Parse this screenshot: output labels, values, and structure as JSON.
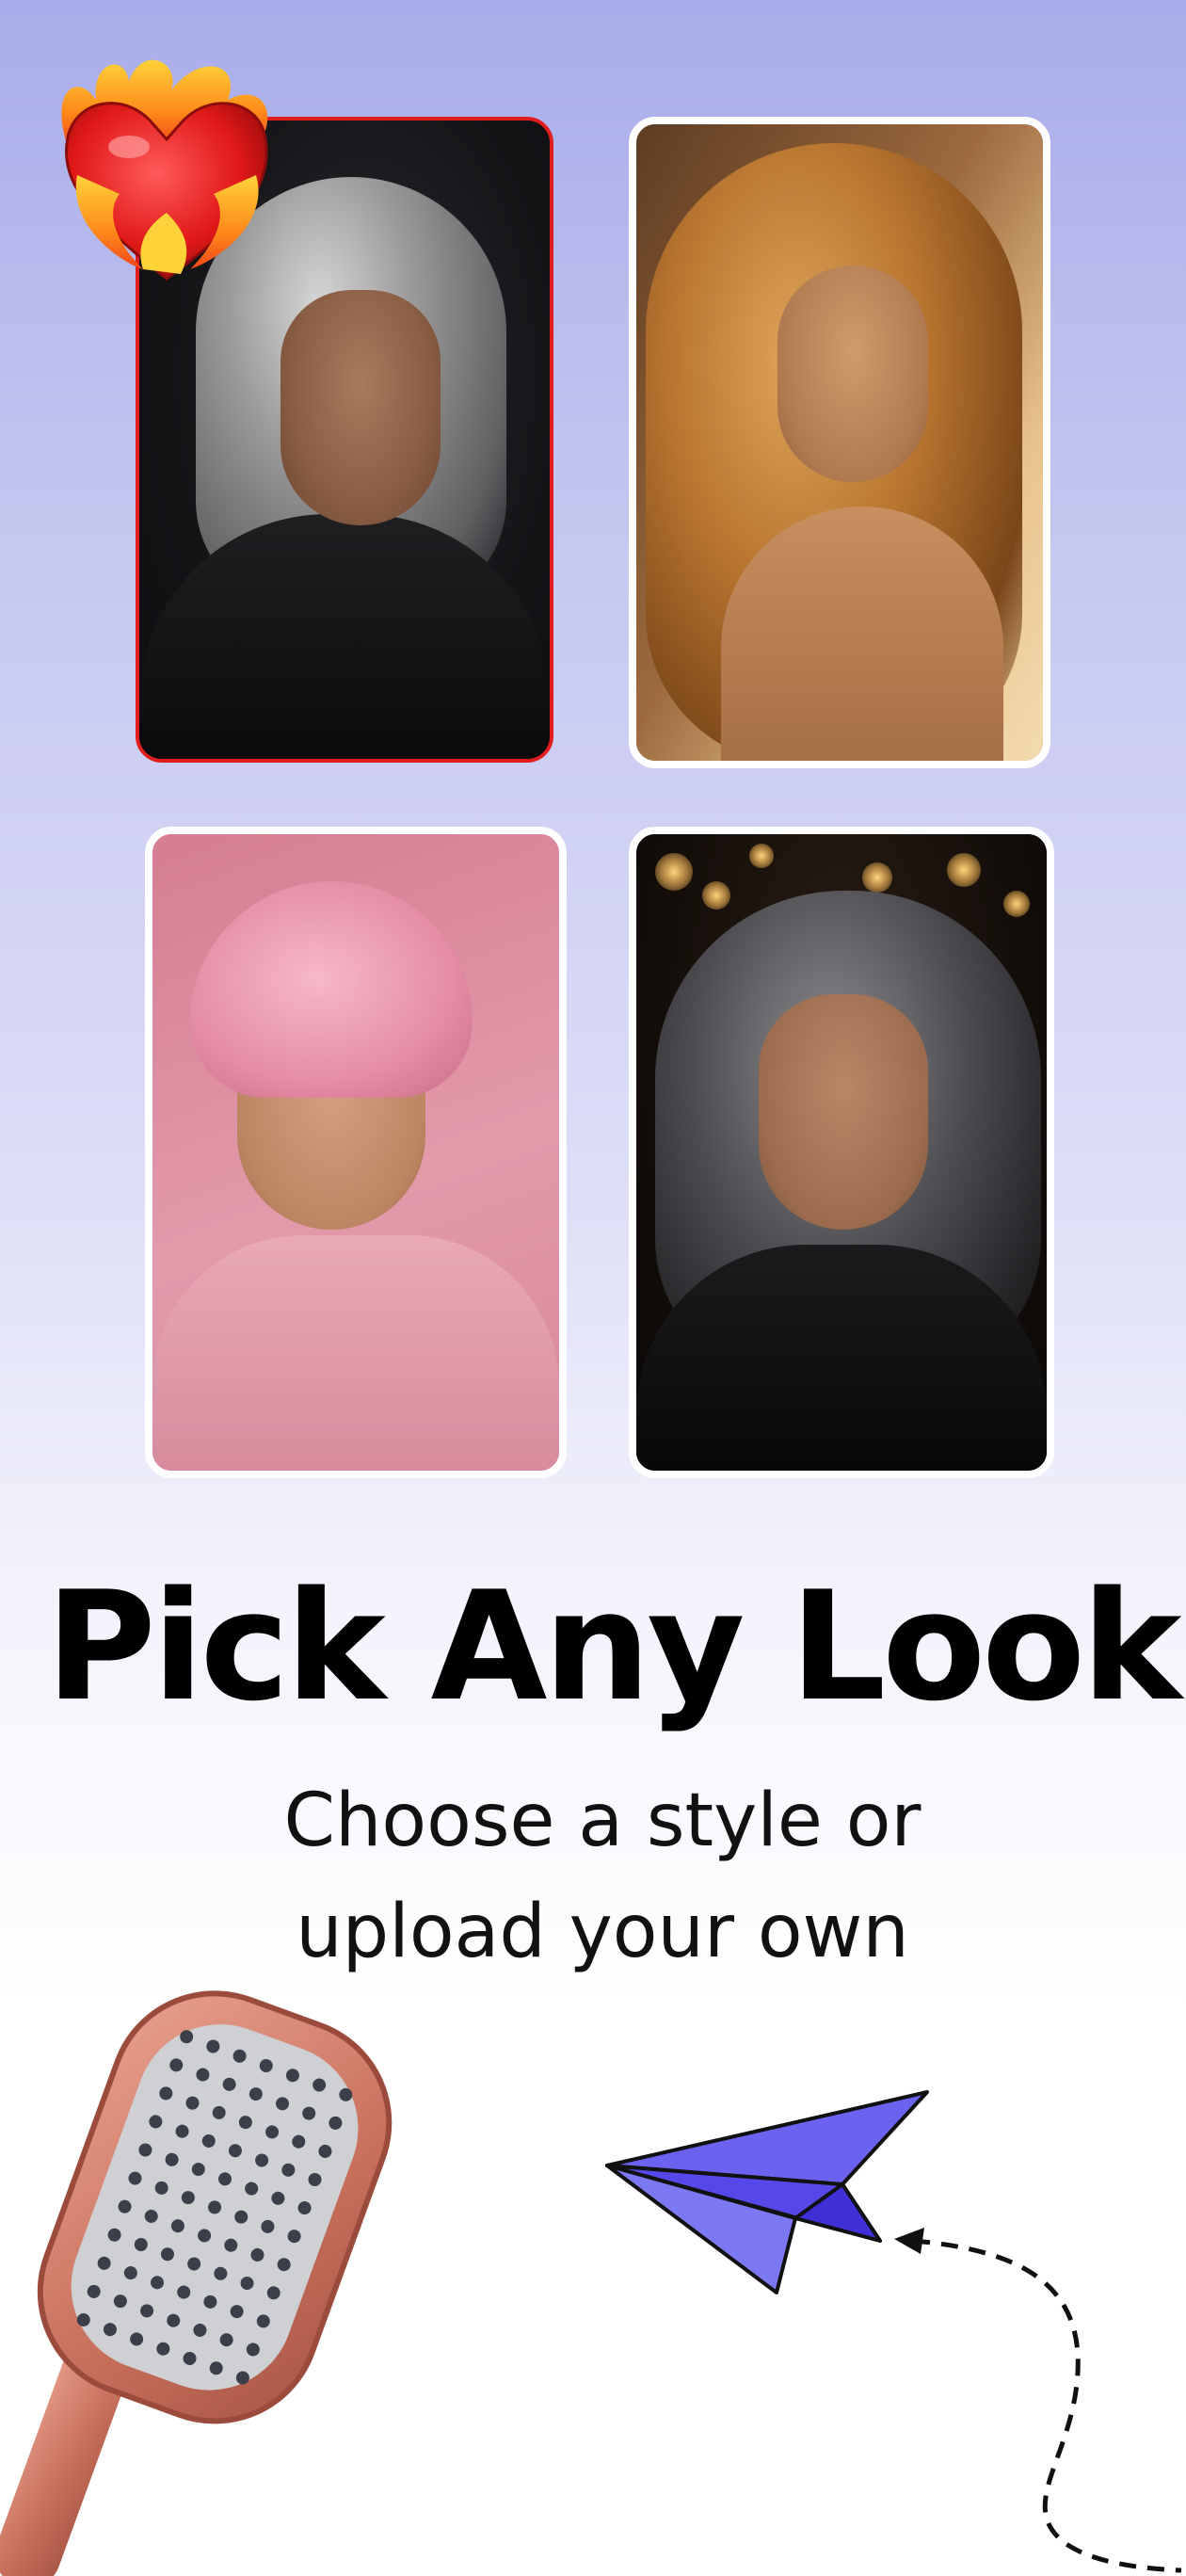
{
  "gallery": {
    "cards": [
      {
        "label": "silver-bob-style",
        "selected": true
      },
      {
        "label": "caramel-waves-style",
        "selected": false
      },
      {
        "label": "pink-pixie-style",
        "selected": false
      },
      {
        "label": "dark-silver-waves-style",
        "selected": false
      }
    ],
    "selected_badge_icon": "flaming-heart-icon"
  },
  "headline": {
    "title": "Pick Any Look",
    "subtitle_line1": "Choose a style or",
    "subtitle_line2": "upload your own"
  },
  "decorations": {
    "brush_icon": "hairbrush-illustration",
    "plane_icon": "paper-plane-icon",
    "path_icon": "dashed-arrow-path"
  },
  "colors": {
    "accent_selected": "#e11d1d",
    "plane_fill": "#6b63ef",
    "background_top": "#a8acea"
  }
}
